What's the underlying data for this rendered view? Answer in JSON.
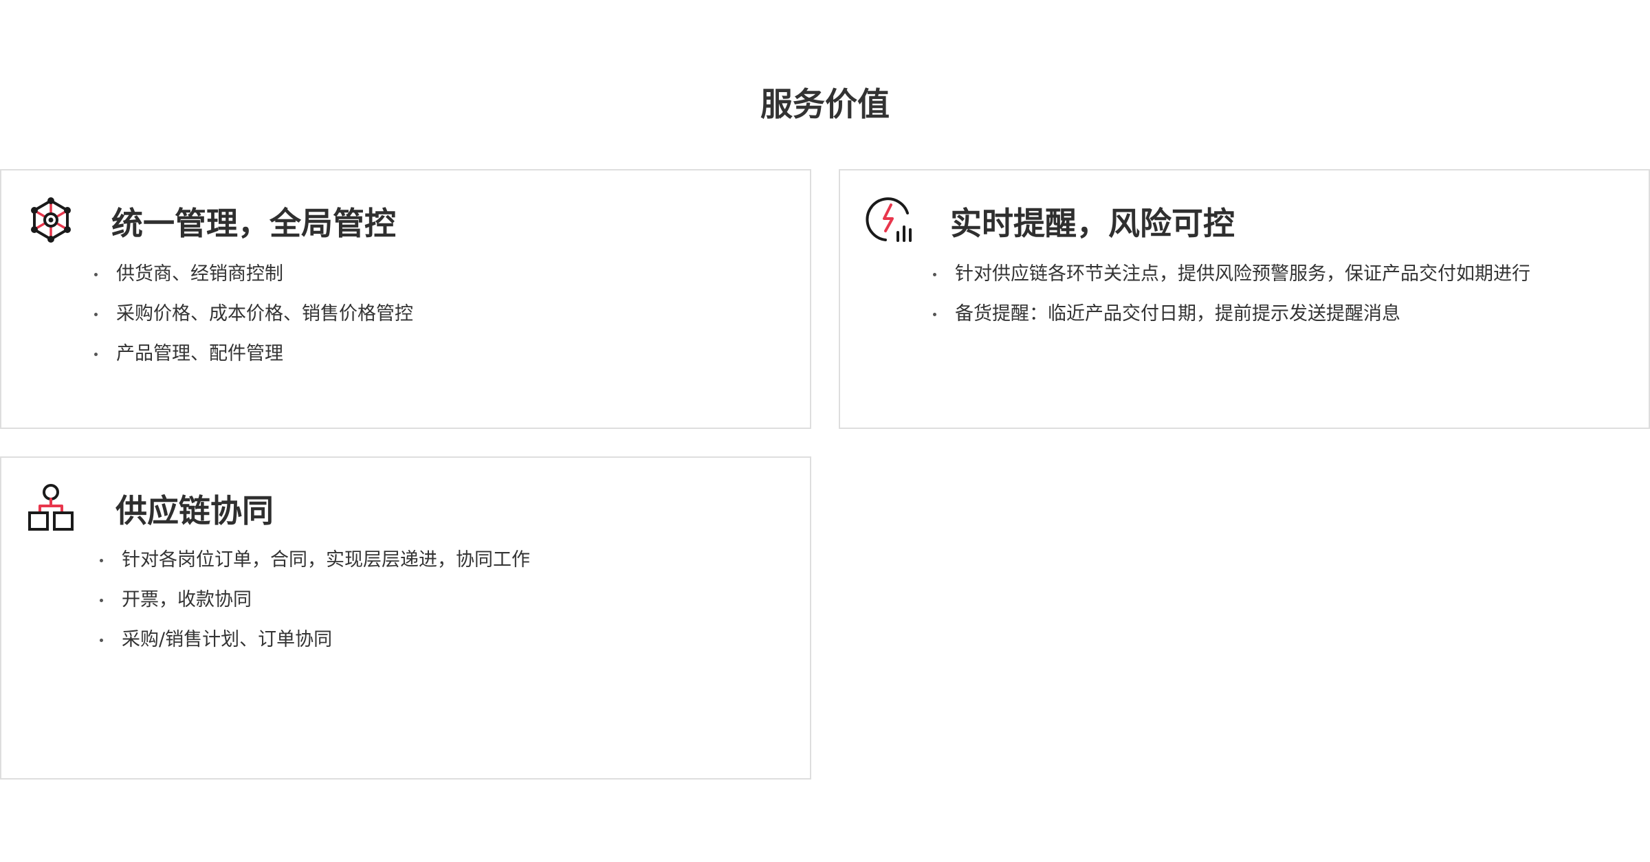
{
  "page": {
    "title": "服务价值"
  },
  "colors": {
    "icon_dark": "#1a1a1a",
    "icon_accent": "#e8364c",
    "card_border": "#dedede",
    "text": "#333333"
  },
  "cards": [
    {
      "icon": "hub-network-icon",
      "title": "统一管理，全局管控",
      "items": [
        "供货商、经销商控制",
        "采购价格、成本价格、销售价格管控",
        "产品管理、配件管理"
      ]
    },
    {
      "icon": "lightning-chart-icon",
      "title": "实时提醒，风险可控",
      "items": [
        "针对供应链各环节关注点，提供风险预警服务，保证产品交付如期进行",
        "备货提醒：临近产品交付日期，提前提示发送提醒消息"
      ]
    },
    {
      "icon": "org-hierarchy-icon",
      "title": "供应链协同",
      "items": [
        "针对各岗位订单，合同，实现层层递进，协同工作",
        "开票，收款协同",
        "采购/销售计划、订单协同"
      ]
    }
  ]
}
